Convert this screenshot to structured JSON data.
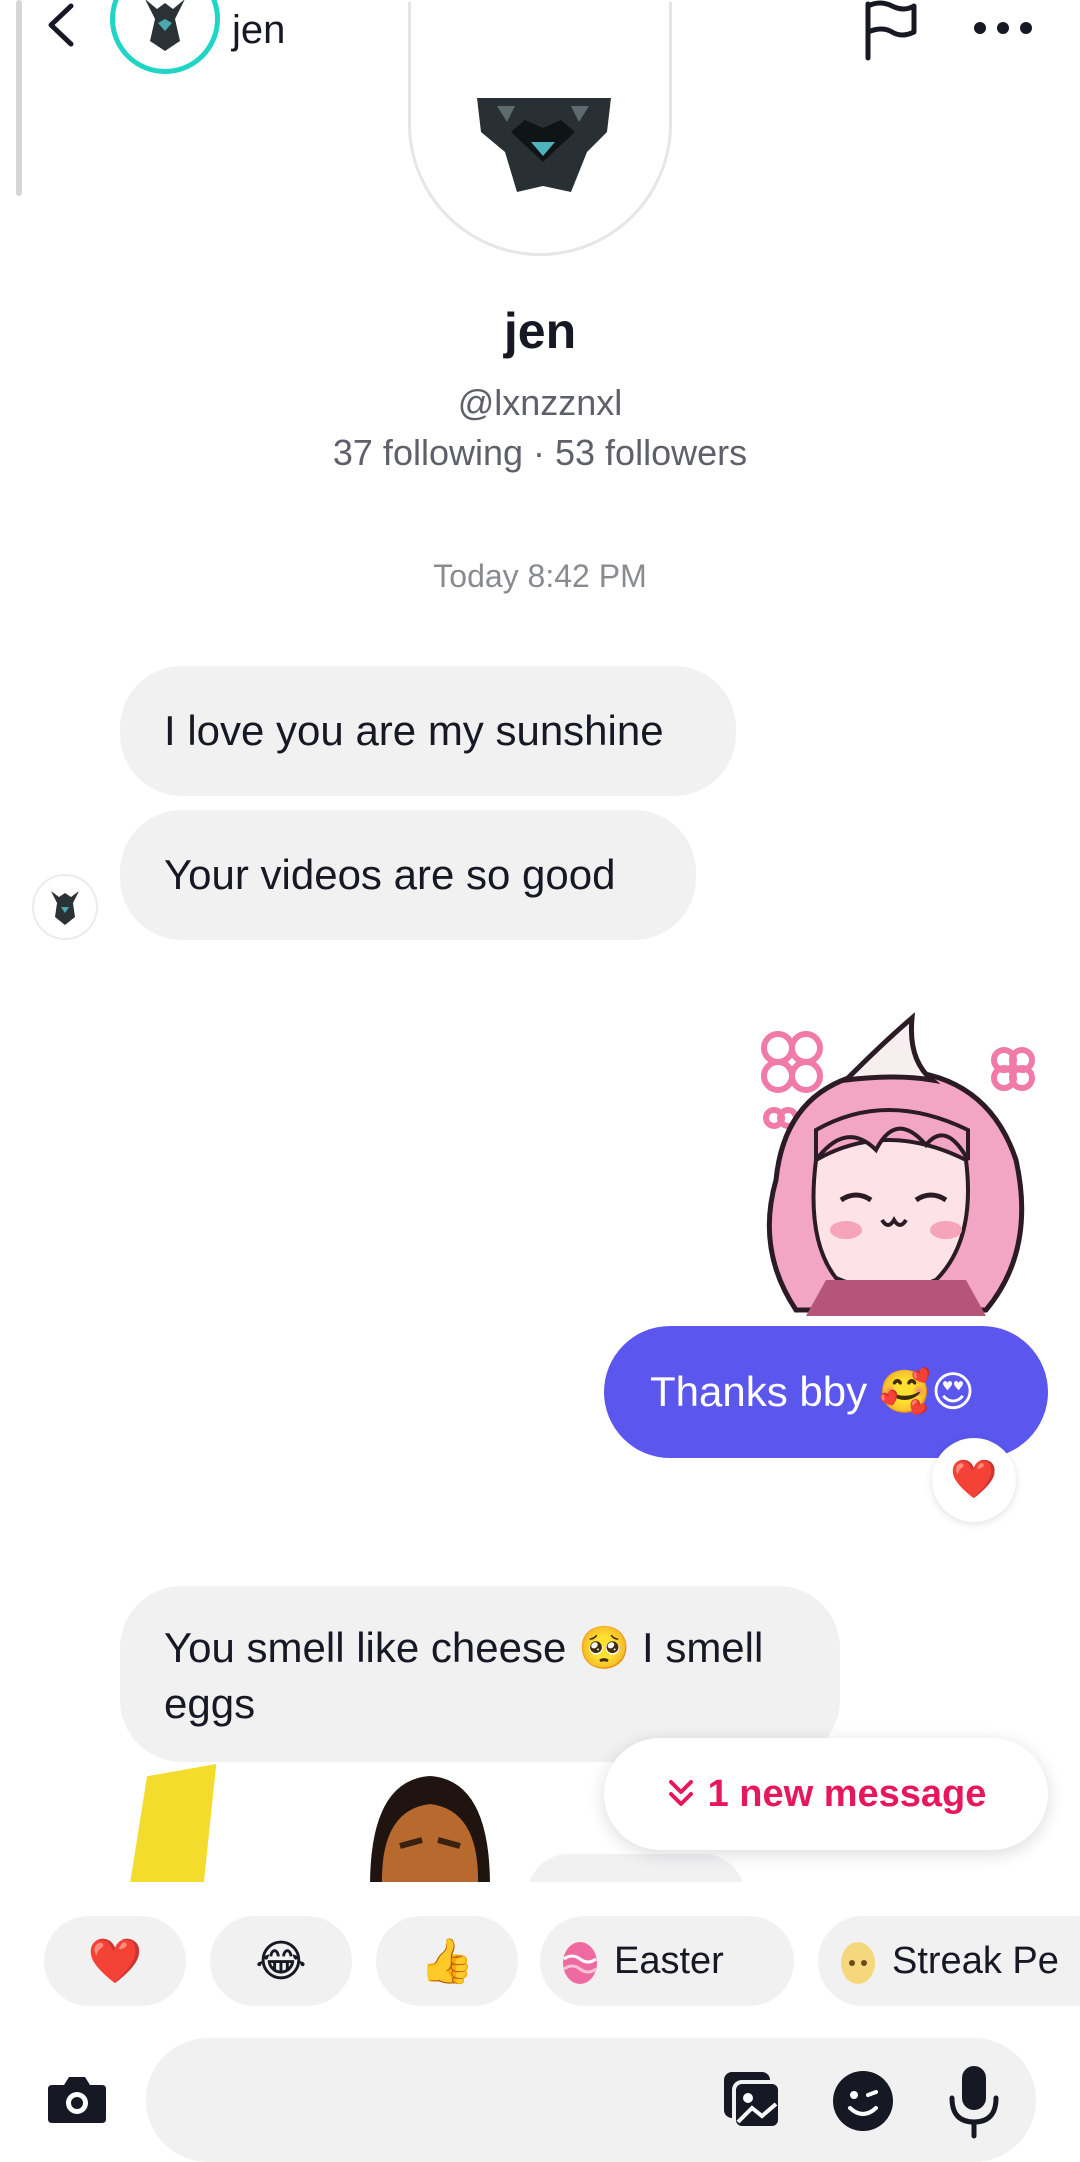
{
  "header": {
    "contact_name": "jen",
    "back_icon": "chevron-left-icon",
    "flag_icon": "flag-icon",
    "more_icon": "more-horizontal-icon",
    "avatar_ring_color": "#1fd5c6"
  },
  "profile": {
    "name": "jen",
    "username": "@lxnzznxl",
    "stats": "37 following · 53 followers"
  },
  "conversation": {
    "timestamp": "Today 8:42 PM",
    "messages": [
      {
        "direction": "incoming",
        "type": "text",
        "text": "I love you are my sunshine"
      },
      {
        "direction": "incoming",
        "type": "text",
        "text": "Your videos are so good"
      },
      {
        "direction": "outgoing",
        "type": "sticker",
        "sticker": "pink-haired-anime-girl-sticker"
      },
      {
        "direction": "outgoing",
        "type": "text",
        "text": "Thanks bby 🥰😍",
        "reaction": "❤️"
      },
      {
        "direction": "incoming",
        "type": "text",
        "text": "You smell like cheese 🥺 I smell eggs"
      }
    ],
    "outgoing_bubble_color": "#5b57ee"
  },
  "new_message_button": {
    "label": "1 new message",
    "icon": "double-chevron-down-icon",
    "color": "#e6185b"
  },
  "quick_reactions": [
    {
      "emoji": "❤️",
      "label": ""
    },
    {
      "emoji": "😂",
      "label": ""
    },
    {
      "emoji": "👍",
      "label": ""
    },
    {
      "emoji": "🥚",
      "label": "Easter"
    },
    {
      "emoji": "🥚",
      "label": "Streak Pe"
    }
  ],
  "composer": {
    "placeholder": "",
    "camera_icon": "camera-icon",
    "gallery_icon": "gallery-icon",
    "sticker_icon": "emoji-face-icon",
    "mic_icon": "microphone-icon"
  }
}
